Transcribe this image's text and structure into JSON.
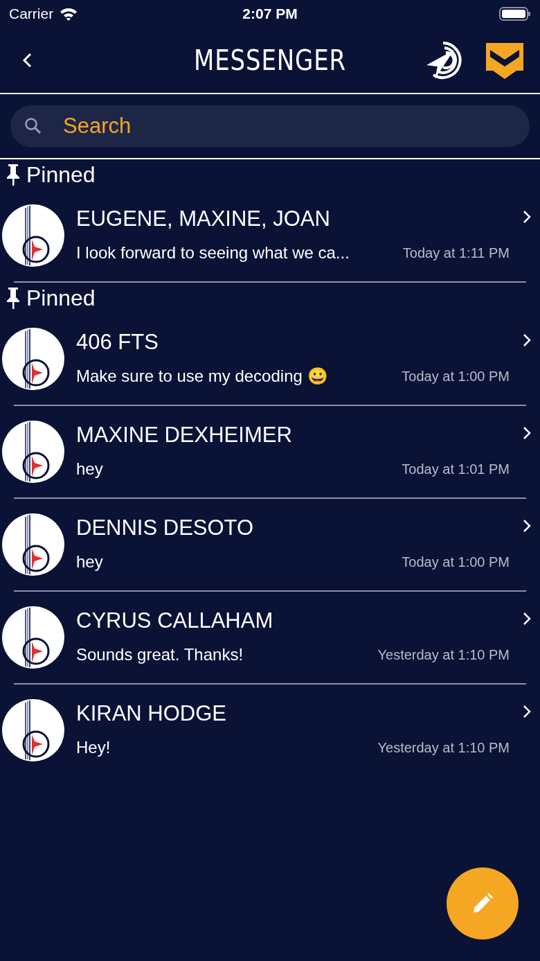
{
  "status_bar": {
    "carrier": "Carrier",
    "time": "2:07 PM"
  },
  "header": {
    "title": "MESSENGER"
  },
  "search": {
    "placeholder": "Search"
  },
  "groups": [
    {
      "header": "Pinned",
      "conversations": [
        {
          "name": "EUGENE, MAXINE, JOAN",
          "message": "I look forward to seeing what we ca...",
          "time": "Today at 1:11 PM"
        }
      ]
    },
    {
      "header": "Pinned",
      "conversations": [
        {
          "name": "406 FTS",
          "message": "Make sure to use my decoding 😀",
          "time": "Today at 1:00 PM"
        },
        {
          "name": "MAXINE DEXHEIMER",
          "message": "hey",
          "time": "Today at 1:01 PM"
        },
        {
          "name": "DENNIS DESOTO",
          "message": "hey",
          "time": "Today at 1:00 PM"
        },
        {
          "name": "CYRUS CALLAHAM",
          "message": "Sounds great. Thanks!",
          "time": "Yesterday at 1:10 PM"
        },
        {
          "name": "KIRAN HODGE",
          "message": "Hey!",
          "time": "Yesterday at 1:10 PM"
        }
      ]
    }
  ]
}
